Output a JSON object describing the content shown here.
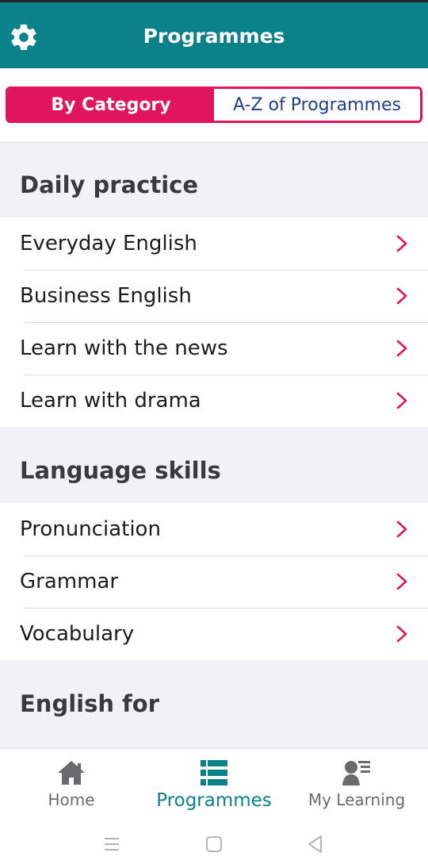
{
  "header": {
    "title": "Programmes",
    "settings_icon": "gear-icon"
  },
  "toggle": {
    "by_category": "By Category",
    "az": "A-Z of Programmes"
  },
  "sections": [
    {
      "heading": "Daily practice",
      "items": [
        "Everyday English",
        "Business English",
        "Learn with the news",
        "Learn with drama"
      ]
    },
    {
      "heading": "Language skills",
      "items": [
        "Pronunciation",
        "Grammar",
        "Vocabulary"
      ]
    },
    {
      "heading": "English for",
      "items": []
    }
  ],
  "nav": {
    "home": "Home",
    "programmes": "Programmes",
    "my_learning": "My Learning"
  },
  "colors": {
    "brand": "#0b8189",
    "accent": "#e0155c",
    "link": "#1f3f88"
  }
}
